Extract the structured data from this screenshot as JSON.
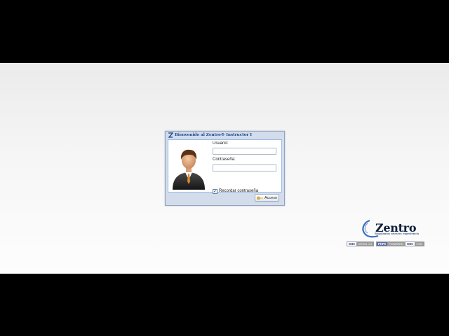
{
  "login": {
    "title": "Bienvenido al Zentro® Instructor I",
    "username_label": "Usuario:",
    "username_value": "",
    "password_label": "Contraseña:",
    "password_value": "",
    "remember_label": "Recordar contraseña",
    "remember_checked": "✓",
    "access_button": "Acceso"
  },
  "brand": {
    "name": "Zentro",
    "tagline": "Regalamos nuestra experiencia"
  },
  "badges": [
    {
      "left": "W3C",
      "right": "XHTML 1.0"
    },
    {
      "left": "PHP5",
      "right": "POWERED"
    },
    {
      "left": "W3C",
      "right": "CSS"
    }
  ],
  "icons": {
    "title": "zentro-z-icon",
    "avatar": "user-avatar-icon",
    "button": "key-icon",
    "logo": "zentro-swirl-icon"
  },
  "colors": {
    "title_text": "#15428b",
    "window_bg": "#d3dcea",
    "window_border": "#8fa4c6"
  }
}
